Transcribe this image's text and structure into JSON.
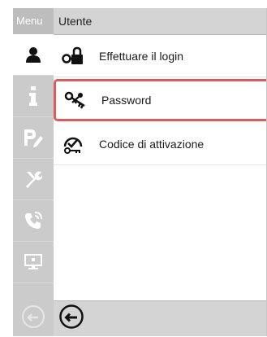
{
  "sidebar": {
    "title": "Menu",
    "items": [
      {
        "icon": "user-icon",
        "active": true
      },
      {
        "icon": "info-icon",
        "active": false
      },
      {
        "icon": "settings-edit-icon",
        "active": false
      },
      {
        "icon": "tools-icon",
        "active": false
      },
      {
        "icon": "phone-icon",
        "active": false
      },
      {
        "icon": "monitor-icon",
        "active": false
      }
    ]
  },
  "main": {
    "title": "Utente",
    "items": [
      {
        "label": "Effettuare il login",
        "icon": "lock-key-icon"
      },
      {
        "label": "Password",
        "icon": "keys-icon",
        "highlighted": true
      },
      {
        "label": "Codice di attivazione",
        "icon": "activation-code-icon"
      }
    ]
  },
  "footer": {
    "back_icon": "back-arrow-icon"
  },
  "colors": {
    "highlight": "#e05a5a",
    "sidebar": "#cbcbcb",
    "header": "#d4d4d4"
  }
}
